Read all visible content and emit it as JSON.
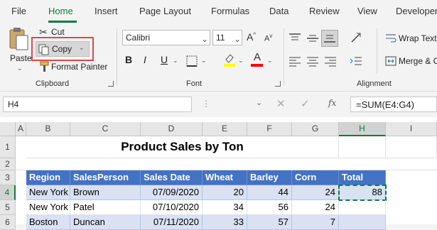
{
  "tabs": [
    "File",
    "Home",
    "Insert",
    "Page Layout",
    "Formulas",
    "Data",
    "Review",
    "View",
    "Developer"
  ],
  "active_tab": "Home",
  "clipboard": {
    "paste": "Paste",
    "cut": "Cut",
    "copy": "Copy",
    "format_painter": "Format Painter",
    "group_label": "Clipboard"
  },
  "font": {
    "name": "Calibri",
    "size": "11",
    "group_label": "Font",
    "bold": "B",
    "italic": "I",
    "underline": "U",
    "font_color_letter": "A",
    "highlight_color": "#ffff00",
    "font_color": "#ff0000"
  },
  "alignment": {
    "wrap_text": "Wrap Text",
    "merge": "Merge & C",
    "group_label": "Alignment"
  },
  "formula_bar": {
    "name_box": "H4",
    "fx": "fx",
    "formula": "=SUM(E4:G4)"
  },
  "columns": [
    "A",
    "B",
    "C",
    "D",
    "E",
    "F",
    "G",
    "H",
    "I"
  ],
  "selected_column": "H",
  "rows": [
    "1",
    "2",
    "3",
    "4",
    "5",
    "6"
  ],
  "selected_row": "4",
  "sheet": {
    "title": "Product Sales by Ton",
    "headers": [
      "Region",
      "SalesPerson",
      "Sales Date",
      "Wheat",
      "Barley",
      "Corn",
      "Total"
    ],
    "data": [
      [
        "New York",
        "Brown",
        "07/09/2020",
        "20",
        "44",
        "24",
        "88"
      ],
      [
        "New York",
        "Patel",
        "07/10/2020",
        "34",
        "56",
        "24",
        ""
      ],
      [
        "Boston",
        "Duncan",
        "07/11/2020",
        "33",
        "57",
        "7",
        ""
      ]
    ]
  },
  "colors": {
    "accent": "#107c41",
    "header_fill": "#4472c4",
    "band_fill": "#d9e1f2",
    "highlight_box": "#e04848"
  }
}
